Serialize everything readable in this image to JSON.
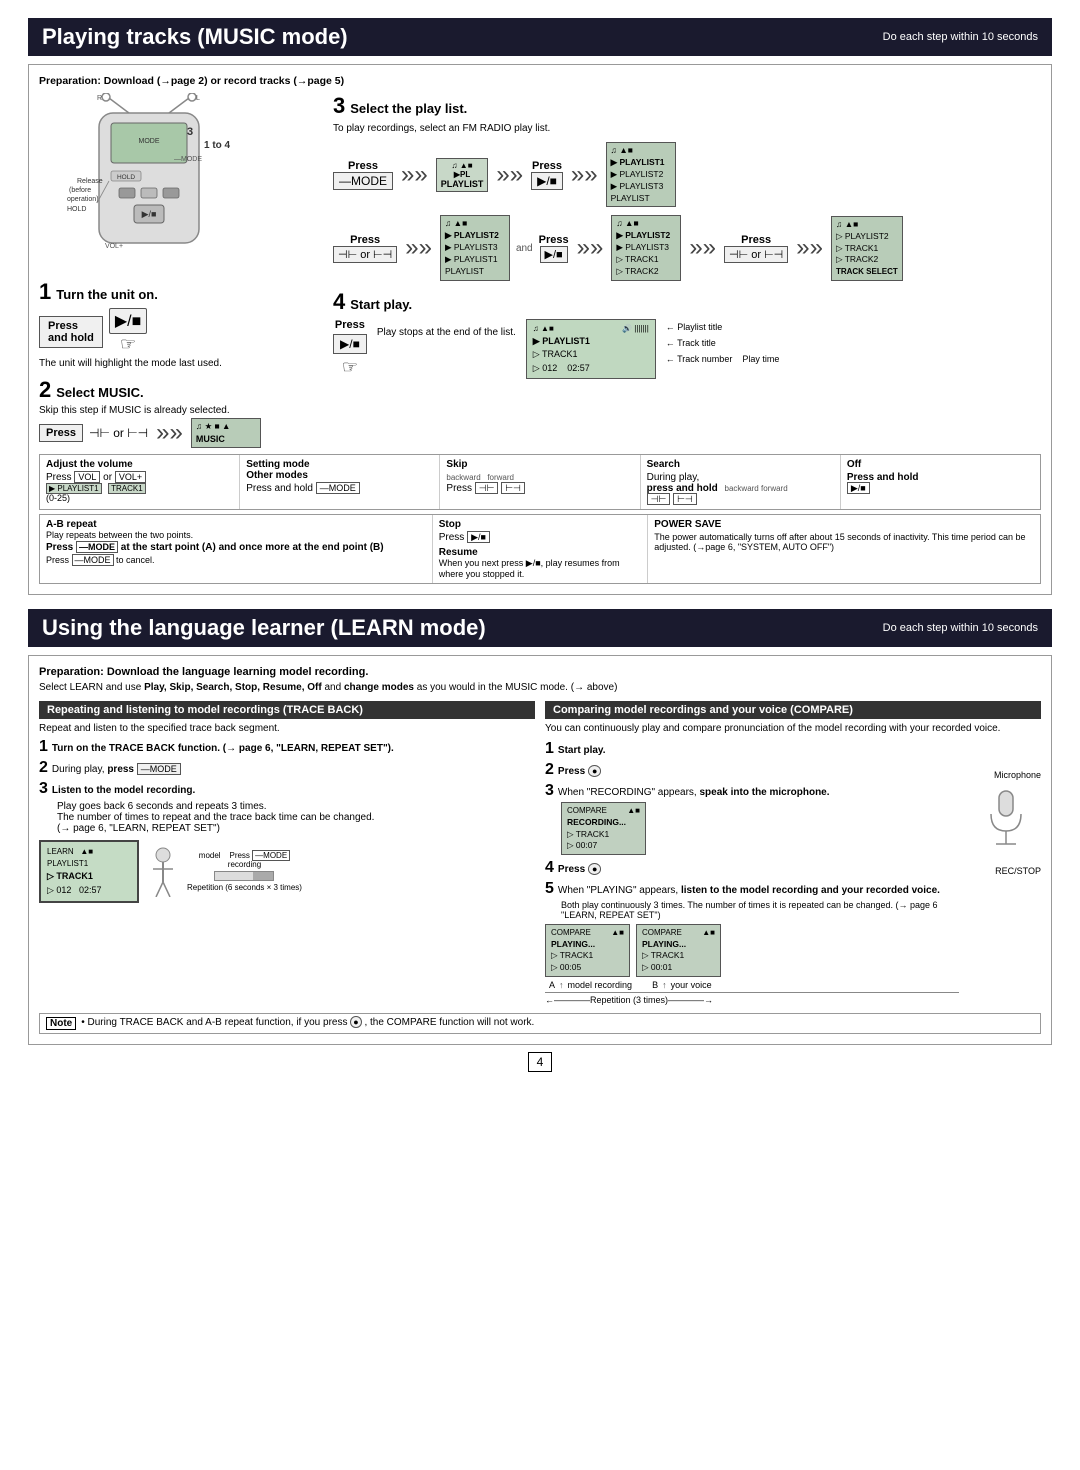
{
  "music_mode": {
    "title": "Playing tracks (MUSIC mode)",
    "do_each": "Do each step within 10 seconds",
    "prep": "Preparation: Download (→page 2) or record tracks (→page 5)",
    "step1": {
      "num": "1",
      "title": "Turn the unit on.",
      "press_label": "Press",
      "press_sub": "and hold",
      "note": "The unit will highlight the mode last used."
    },
    "step2": {
      "num": "2",
      "title": "Select MUSIC.",
      "note": "Skip this step if MUSIC is already selected.",
      "press_label": "Press",
      "mode_label": "MUSIC"
    },
    "step3": {
      "num": "3",
      "title": "Select the play list.",
      "sub": "To play recordings, select an FM RADIO play list.",
      "press1": "Press",
      "press2": "Press",
      "press3": "Press",
      "press4": "Press",
      "press5": "Press",
      "playlist_screen1": "PLAYLIST",
      "playlist_screen2_lines": [
        "PLAYLIST1",
        "PLAYLIST2",
        "PLAYLIST3",
        "PLAYLIST"
      ],
      "playlist_screen3_lines": [
        "PLAYLIST2",
        "PLAYLIST3",
        "PLAYLIST1",
        "PLAYLIST"
      ],
      "playlist_screen4_lines": [
        "PLAYLIST2",
        "PLAYLIST3",
        "TRACK1",
        "TRACK2",
        "TRACK SELECT"
      ],
      "playlist_screen5_lines": [
        "PLAYLIST2",
        "TRACK1",
        "TRACK2",
        "TRACK SELECT"
      ]
    },
    "step4": {
      "num": "4",
      "title": "Start play.",
      "press_label": "Press",
      "play_note": "Play stops at the end of the list.",
      "track_display": {
        "line1": "PLAYLIST1",
        "line2": "TRACK1",
        "line3": "012    02:57",
        "labels": [
          "Playlist title",
          "Track title",
          "Track number",
          "Play time"
        ]
      }
    },
    "volume_row": {
      "adjust": {
        "label": "Adjust the volume",
        "value": "Press  or",
        "range": "(0-25)"
      },
      "setting_mode": {
        "label": "Setting mode\nOther modes",
        "value": "Press and hold"
      },
      "skip": {
        "label": "Skip",
        "value": "Press backward/forward"
      },
      "search": {
        "label": "Search",
        "value": "During play,\npress and hold"
      },
      "off": {
        "label": "Off",
        "value": "Press and hold"
      }
    },
    "ab_repeat": {
      "label": "A-B repeat",
      "sub": "Play repeats between the two points.",
      "value": "Press at the start point (A) and once more at the end point (B)",
      "cancel": "Press to cancel."
    },
    "stop": {
      "label": "Stop",
      "value": "Press"
    },
    "resume": {
      "label": "Resume",
      "value": "When you next press, play resumes from where you stopped it."
    },
    "power_save": {
      "label": "POWER SAVE",
      "value": "The power automatically turns off after about 15 seconds of inactivity. This time period can be adjusted. (→page 6, \"SYSTEM, AUTO OFF\")"
    }
  },
  "learn_mode": {
    "title": "Using the language learner (LEARN mode)",
    "do_each": "Do each step within 10 seconds",
    "prep1": "Preparation: Download the language learning model recording.",
    "prep2": "Select LEARN and use Play, Skip, Search, Stop, Resume, Off and change modes as you would in the MUSIC mode. (→ above)",
    "trace_back": {
      "title": "Repeating and listening to model recordings (TRACE BACK)",
      "sub": "Repeat and listen to the specified trace back segment.",
      "step1": {
        "num": "1",
        "text": "Turn on the TRACE BACK function. (→ page 6, \"LEARN, REPEAT SET\")."
      },
      "step2": {
        "num": "2",
        "text": "During play, press"
      },
      "step3": {
        "num": "3",
        "title": "Listen to the model recording.",
        "lines": [
          "Play goes back 6 seconds and repeats 3 times.",
          "The number of times to repeat and the trace back time can be changed.",
          "(→ page 6, \"LEARN, REPEAT SET\")"
        ]
      },
      "screen": {
        "line1": "LEARN",
        "line2": "PLAYLIST1",
        "line3": "TRACK1",
        "line4": "012    02:57"
      },
      "repetition": "Repetition (6 seconds × 3 times)"
    },
    "compare": {
      "title": "Comparing model recordings and your voice (COMPARE)",
      "sub": "You can continuously play and compare pronunciation of the model recording with your recorded voice.",
      "step1": {
        "num": "1",
        "text": "Start play."
      },
      "step2": {
        "num": "2",
        "text": "Press"
      },
      "step3": {
        "num": "3",
        "text_before": "When \"RECORDING\" appears,",
        "text_bold": "speak into the microphone.",
        "screen": {
          "line1": "COMPARE",
          "line2": "RECORDING...",
          "line3": "TRACK1",
          "line4": "00:07"
        },
        "mic_label": "Microphone",
        "rec_stop_label": "REC/STOP"
      },
      "step4": {
        "num": "4",
        "text": "Press"
      },
      "step5": {
        "num": "5",
        "text_before": "When \"PLAYING\" appears,",
        "text_bold": "listen to the model recording and your recorded voice.",
        "sub_lines": [
          "Both play continuously 3 times. The number of times it is repeated can be changed. (→ page 6 \"LEARN, REPEAT SET\")"
        ],
        "screen1": {
          "line1": "COMPARE",
          "line2": "PLAYING...",
          "line3": "TRACK1",
          "line4": "00:05"
        },
        "screen2": {
          "line1": "COMPARE",
          "line2": "PLAYING...",
          "line3": "TRACK1",
          "line4": "00:01"
        },
        "label_a": "model recording",
        "label_b": "your voice",
        "repetition": "Repetition (3 times)"
      }
    },
    "note": "During TRACE BACK and A-B repeat function, if you press      , the COMPARE function will not work."
  },
  "page_number": "4"
}
